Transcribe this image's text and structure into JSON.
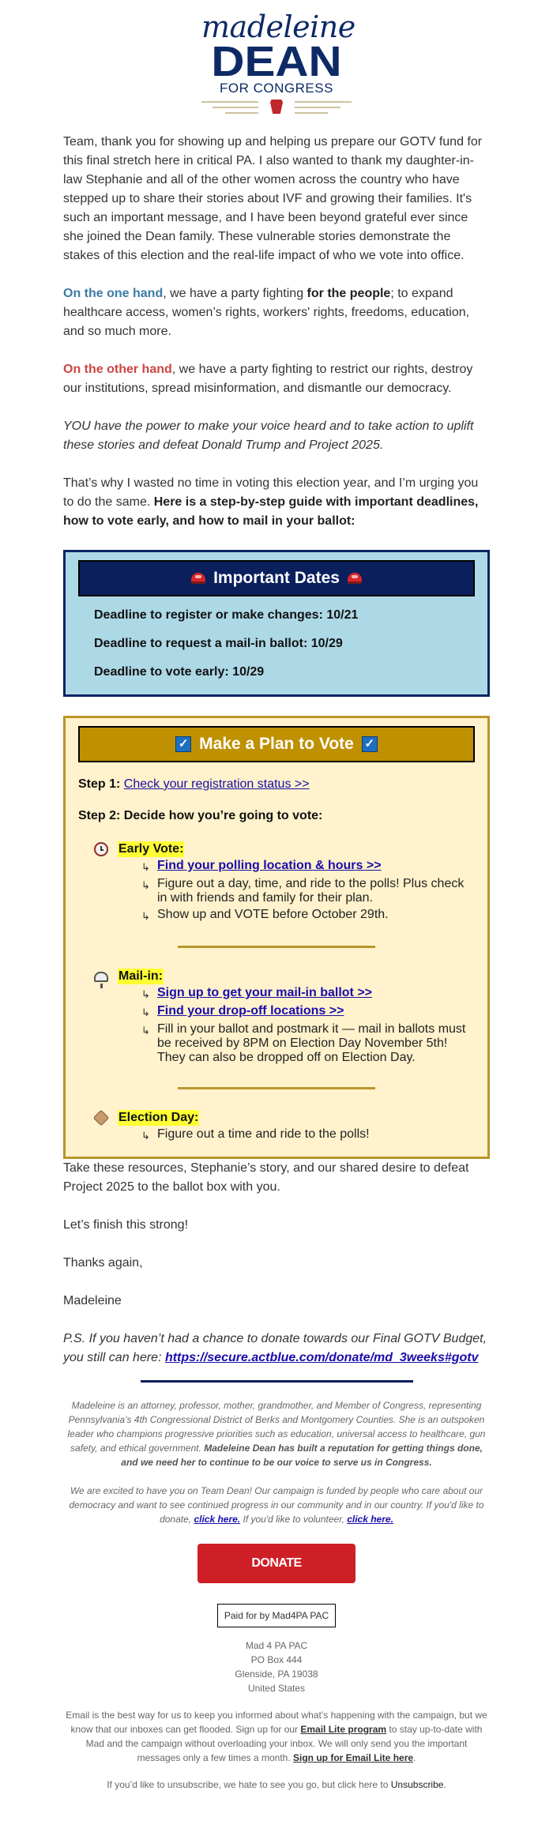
{
  "logo": {
    "script": "madeleine",
    "name": "DEAN",
    "tagline": "FOR CONGRESS"
  },
  "intro": "Team, thank you for showing up and helping us prepare our GOTV fund for this final stretch here in critical PA. I also wanted to thank my daughter-in-law Stephanie and all of the other women across the country who have stepped up to share their stories about IVF and growing their families. It's such an important message, and I have been beyond grateful ever since she joined the Dean family. These vulnerable stories demonstrate the stakes of this election and the real-life impact of who we vote into office.",
  "one_hand": {
    "lead": "On the one hand",
    "pre": ", we have a party fighting ",
    "bold": "for the people",
    "post": "; to expand healthcare access, women’s rights, workers' rights, freedoms, education, and so much more."
  },
  "other_hand": {
    "lead": "On the other hand",
    "rest": ", we have a party fighting to restrict our rights, destroy our institutions, spread misinformation, and dismantle our democracy."
  },
  "power": "YOU have the power to make your voice heard and to take action to uplift these stories and defeat Donald Trump and Project 2025.",
  "urging": {
    "plain": "That’s why I wasted no time in voting this election year, and I’m urging you to do the same. ",
    "bold": "Here is a step-by-step guide with important deadlines, how to vote early, and how to mail in your ballot:"
  },
  "important_dates": {
    "title": "Important Dates",
    "icon": "police-siren-icon",
    "items": [
      "Deadline to register or make changes: 10/21",
      "Deadline to request a mail-in ballot: 10/29",
      "Deadline to vote early: 10/29"
    ],
    "colors": {
      "background": "#add8e6",
      "header": "#0a1f5c",
      "border": "#0a2463"
    }
  },
  "plan": {
    "title": "Make a Plan to Vote",
    "icon": "check-box-icon",
    "step1_label": "Step 1:",
    "step1_link": "Check your registration status >>",
    "step2_label": "Step 2:",
    "step2_text": "Decide how you’re going to vote:",
    "arrow": "↳",
    "colors": {
      "background": "#fff2cc",
      "header": "#bf9000",
      "border": "#b8962a",
      "highlight": "#ffff33"
    },
    "early": {
      "icon": "alarm-clock-icon",
      "title": "Early Vote:",
      "link": "Find your polling location & hours >>",
      "items": [
        "Figure out a day, time, and ride to the polls! Plus check in with friends and family for their plan.",
        "Show up and VOTE before October 29th."
      ]
    },
    "mail": {
      "icon": "mailbox-icon",
      "title": "Mail-in:",
      "links": [
        "Sign up to get your mail-in ballot >>",
        "Find your drop-off locations >>"
      ],
      "items": [
        "Fill in your ballot and postmark it — mail in ballots must be received by 8PM on Election Day November 5th! They can also be dropped off on Election Day."
      ]
    },
    "election_day": {
      "icon": "ballot-box-icon",
      "title": "Election Day:",
      "items": [
        "Figure out a time and ride to the polls!"
      ]
    }
  },
  "closing": {
    "resources": "Take these resources, Stephanie’s story, and our shared desire to defeat Project 2025 to the ballot box with you.",
    "finish": "Let’s finish this strong!",
    "thanks": "Thanks again,",
    "signature": "Madeleine",
    "ps_text": "P.S. If you haven’t had a chance to donate towards our Final GOTV Budget, you still can here: ",
    "ps_link": "https://secure.actblue.com/donate/md_3weeks#gotv"
  },
  "footer": {
    "bio_plain": "Madeleine is an attorney, professor, mother, grandmother, and Member of Congress, representing Pennsylvania’s 4th Congressional District of Berks and Montgomery Counties. She is an outspoken leader who champions progressive priorities such as education, universal access to healthcare, gun safety, and ethical government. ",
    "bio_bold": "Madeleine Dean has built a reputation for getting things done, and we need her to continue to be our voice to serve us in Congress.",
    "team_text": "We are excited to have you on Team Dean! Our campaign is funded by people who care about our democracy and want to see continued progress in our community and in our country. If you'd like to donate, ",
    "donate_link": "click here.",
    "volunteer_text": " If you'd like to volunteer, ",
    "volunteer_link": "click here.",
    "donate_button": "DONATE",
    "donate_color": "#cf1f26",
    "paid_for": "Paid for by Mad4PA PAC",
    "address": [
      "Mad 4 PA PAC",
      "PO Box 444",
      "Glenside, PA 19038",
      "United States"
    ],
    "email_lite_1": "Email is the best way for us to keep you informed about what’s happening with the campaign, but we know that our inboxes can get flooded. Sign up for our ",
    "email_lite_link1": "Email Lite program",
    "email_lite_2": " to stay up-to-date with Mad and the campaign without overloading your inbox. We will only send you the important messages only a few times a month. ",
    "email_lite_link2": "Sign up for Email Lite here",
    "email_lite_3": ".",
    "unsub_text": "If you’d like to unsubscribe, we hate to see you go, but click here to ",
    "unsub_link": "Unsubscribe",
    "unsub_end": "."
  }
}
